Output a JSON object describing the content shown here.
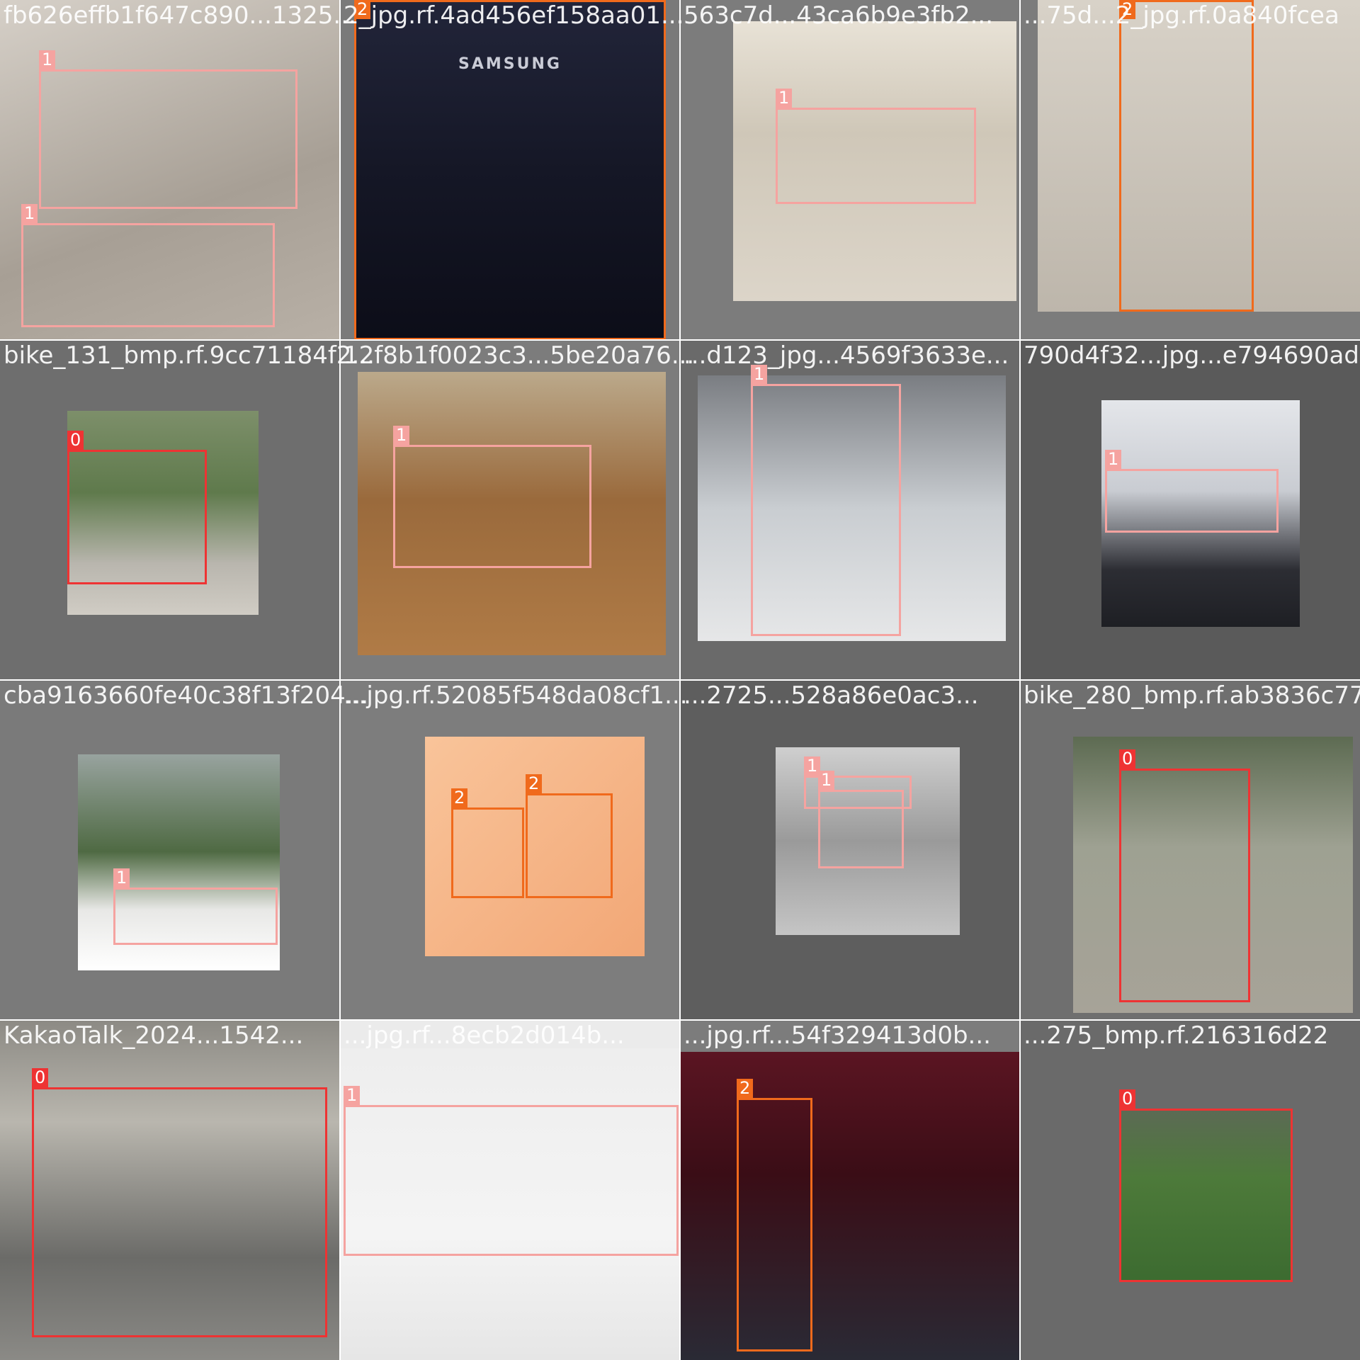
{
  "class_colors": {
    "0": "#ee3333",
    "1": "#f5a3a0",
    "2": "#f06a1c"
  },
  "tiles": [
    {
      "filename": "fb626effb1f647c890...1325...",
      "boxes": [
        {
          "label": "1"
        },
        {
          "label": "1"
        }
      ]
    },
    {
      "filename": "2_jpg.rf.4ad456ef158aa01...",
      "boxes": [
        {
          "label": "2"
        }
      ],
      "brand": "SAMSUNG"
    },
    {
      "filename": "563c7d...43ca6b9e3fb2...",
      "boxes": [
        {
          "label": "1"
        }
      ]
    },
    {
      "filename": "...75d...2_jpg.rf.0a840fcea",
      "boxes": [
        {
          "label": "2"
        }
      ]
    },
    {
      "filename": "bike_131_bmp.rf.9cc71184f2...",
      "boxes": [
        {
          "label": "0"
        }
      ]
    },
    {
      "filename": "12f8b1f0023c3...5be20a76...",
      "boxes": [
        {
          "label": "1"
        }
      ]
    },
    {
      "filename": "...d123_jpg...4569f3633e...",
      "boxes": [
        {
          "label": "1"
        }
      ]
    },
    {
      "filename": "790d4f32...jpg...e794690ad",
      "boxes": [
        {
          "label": "1"
        }
      ]
    },
    {
      "filename": "cba9163660fe40c38f13f204...",
      "boxes": [
        {
          "label": "1"
        }
      ]
    },
    {
      "filename": "...jpg.rf.52085f548da08cf1...",
      "boxes": [
        {
          "label": "2"
        },
        {
          "label": "2"
        }
      ]
    },
    {
      "filename": "...2725...528a86e0ac3...",
      "boxes": [
        {
          "label": "1"
        },
        {
          "label": "1"
        }
      ]
    },
    {
      "filename": "bike_280_bmp.rf.ab3836c77",
      "boxes": [
        {
          "label": "0"
        }
      ]
    },
    {
      "filename": "KakaoTalk_2024...1542...",
      "boxes": [
        {
          "label": "0"
        }
      ]
    },
    {
      "filename": "...jpg.rf...8ecb2d014b...",
      "boxes": [
        {
          "label": "1"
        }
      ]
    },
    {
      "filename": "...jpg.rf...54f329413d0b...",
      "boxes": [
        {
          "label": "2"
        }
      ]
    },
    {
      "filename": "...275_bmp.rf.216316d22",
      "boxes": [
        {
          "label": "0"
        }
      ]
    }
  ]
}
